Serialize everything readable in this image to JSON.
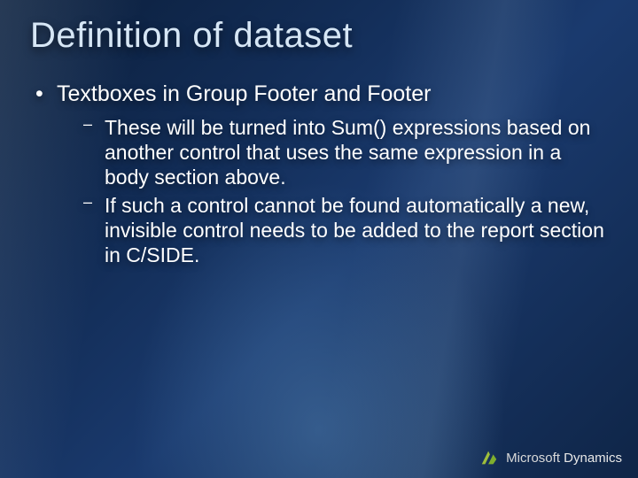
{
  "title": "Definition of dataset",
  "bullets": {
    "level1_0": "Textboxes in Group Footer and Footer",
    "level2_0": "These will be turned into Sum() expressions based on another control that uses the same expression in a body section above.",
    "level2_1": "If such a control cannot be found automatically a new, invisible control needs to be added to the report section in C/SIDE."
  },
  "footer": {
    "brand_prefix": "Microsoft",
    "brand_suffix": " Dynamics"
  }
}
